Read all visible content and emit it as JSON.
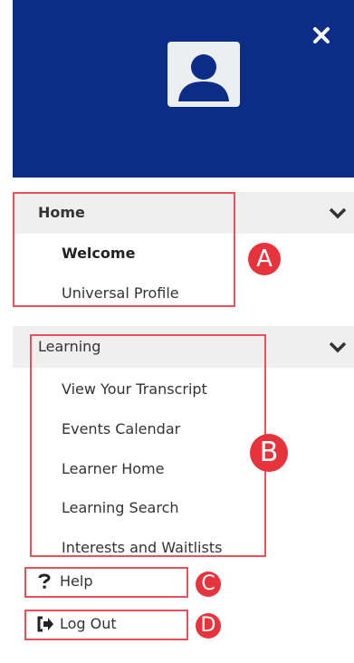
{
  "colors": {
    "header_bg": "#0b2d87",
    "section_bg": "#efefef",
    "annotation_red": "#e8323c",
    "text": "#333333"
  },
  "header": {
    "close_icon": "close-icon",
    "avatar_icon": "user-avatar-icon"
  },
  "sections": {
    "home": {
      "title": "Home",
      "items": [
        "Welcome",
        "Universal Profile"
      ]
    },
    "learning": {
      "title": "Learning",
      "items": [
        "View Your Transcript",
        "Events Calendar",
        "Learner Home",
        "Learning Search",
        "Interests and Waitlists"
      ]
    }
  },
  "footer_links": {
    "help": {
      "label": "Help",
      "icon": "question-icon"
    },
    "logout": {
      "label": "Log Out",
      "icon": "logout-icon"
    }
  },
  "annotations": [
    "A",
    "B",
    "C",
    "D"
  ]
}
